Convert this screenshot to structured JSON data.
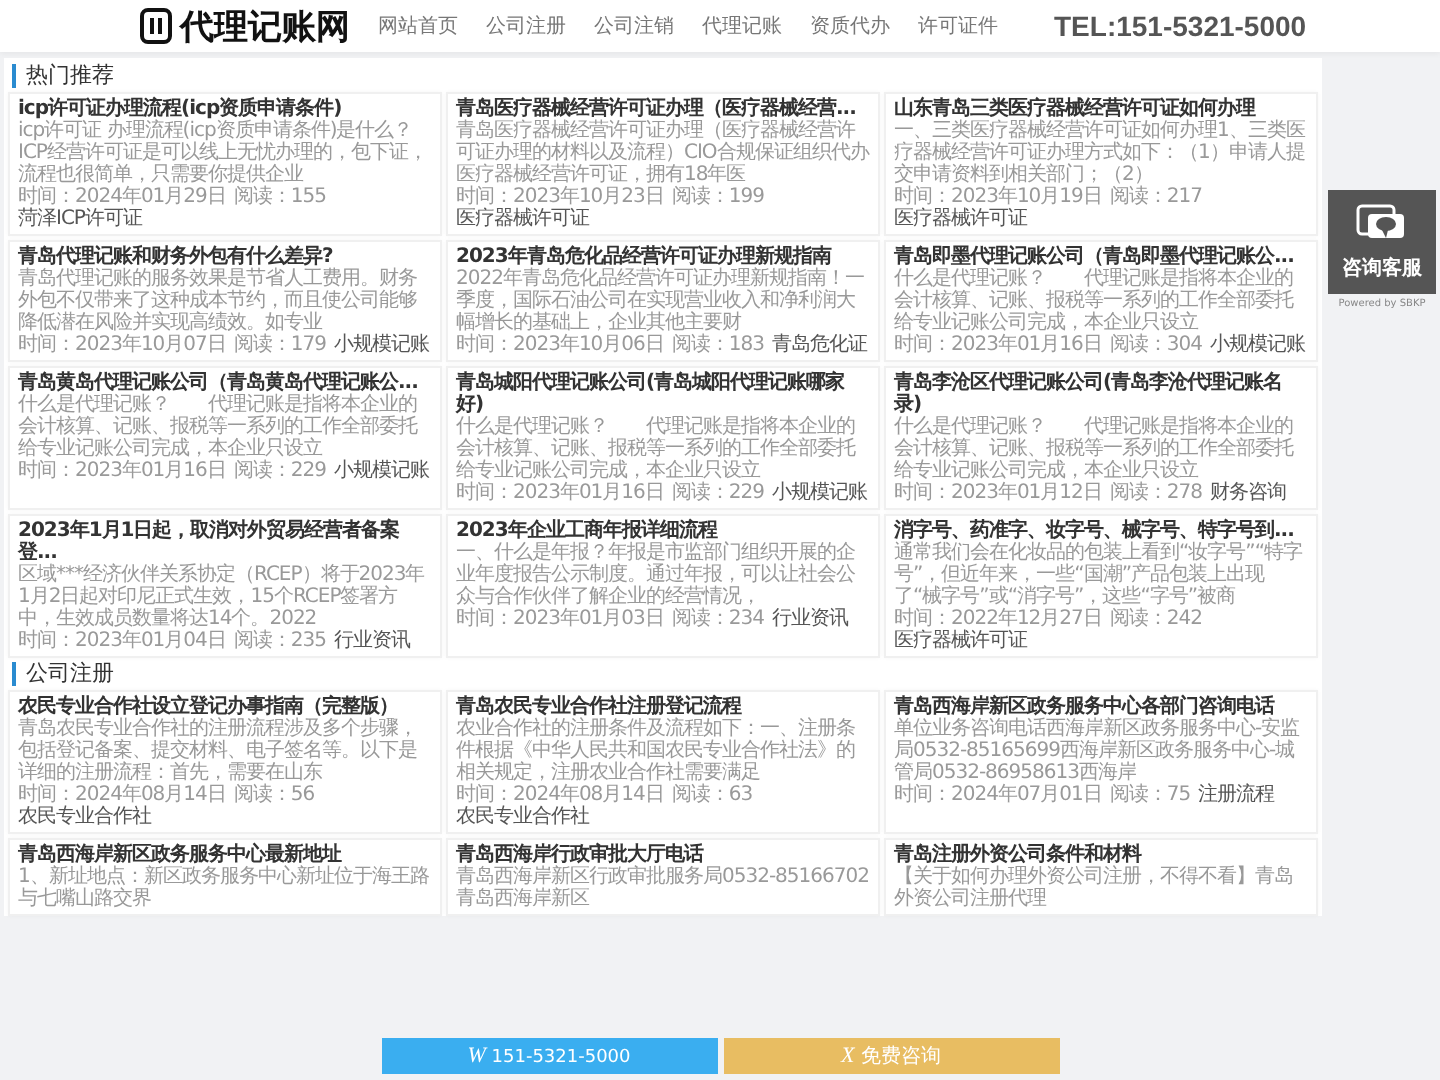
{
  "header": {
    "logo": "代理记账网",
    "nav": [
      {
        "label": "网站首页"
      },
      {
        "label": "公司注册"
      },
      {
        "label": "公司注销"
      },
      {
        "label": "代理记账"
      },
      {
        "label": "资质代办"
      },
      {
        "label": "许可证件"
      }
    ],
    "phone": "TEL:151-5321-5000"
  },
  "sections": [
    {
      "title": "热门推荐",
      "cards": [
        {
          "title": "icp许可证办理流程(icp资质申请条件)",
          "snippet": "icp许可证 办理流程(icp资质申请条件)是什么？ICP经营许可证是可以线上无忧办理的，包下证，流程也很简单，只需要你提供企业",
          "date": "时间：2024年01月29日",
          "reads": "阅读：155",
          "tag": "菏泽ICP许可证"
        },
        {
          "title": "青岛医疗器械经营许可证办理（医疗器械经营...",
          "snippet": "青岛医疗器械经营许可证办理（医疗器械经营许可证办理的材料以及流程）CIO合规保证组织代办医疗器械经营许可证，拥有18年医",
          "date": "时间：2023年10月23日",
          "reads": "阅读：199",
          "tag": "医疗器械许可证"
        },
        {
          "title": "山东青岛三类医疗器械经营许可证如何办理",
          "snippet": "一、三类医疗器械经营许可证如何办理1、三类医疗器械经营许可证办理方式如下：（1）申请人提交申请资料到相关部门；（2）",
          "date": "时间：2023年10月19日",
          "reads": "阅读：217",
          "tag": "医疗器械许可证"
        },
        {
          "title": "青岛代理记账和财务外包有什么差异?",
          "snippet": "青岛代理记账的服务效果是节省人工费用。财务外包不仅带来了这种成本节约，而且使公司能够降低潜在风险并实现高绩效。如专业",
          "date": "时间：2023年10月07日",
          "reads": "阅读：179",
          "tag": "小规模记账"
        },
        {
          "title": "2023年青岛危化品经营许可证办理新规指南",
          "snippet": "2022年青岛危化品经营许可证办理新规指南！一季度，国际石油公司在实现营业收入和净利润大幅增长的基础上，企业其他主要财",
          "date": "时间：2023年10月06日",
          "reads": "阅读：183",
          "tag": "青岛危化证"
        },
        {
          "title": "青岛即墨代理记账公司（青岛即墨代理记账公...",
          "snippet": "什么是代理记账？　　代理记账是指将本企业的会计核算、记账、报税等一系列的工作全部委托给专业记账公司完成，本企业只设立",
          "date": "时间：2023年01月16日",
          "reads": "阅读：304",
          "tag": "小规模记账"
        },
        {
          "title": "青岛黄岛代理记账公司（青岛黄岛代理记账公...",
          "snippet": "什么是代理记账？　　代理记账是指将本企业的会计核算、记账、报税等一系列的工作全部委托给专业记账公司完成，本企业只设立",
          "date": "时间：2023年01月16日",
          "reads": "阅读：229",
          "tag": "小规模记账"
        },
        {
          "title": "青岛城阳代理记账公司(青岛城阳代理记账哪家好)",
          "snippet": "什么是代理记账？　　代理记账是指将本企业的会计核算、记账、报税等一系列的工作全部委托给专业记账公司完成，本企业只设立",
          "date": "时间：2023年01月16日",
          "reads": "阅读：229",
          "tag": "小规模记账"
        },
        {
          "title": "青岛李沧区代理记账公司(青岛李沧代理记账名录)",
          "snippet": "什么是代理记账？　　代理记账是指将本企业的会计核算、记账、报税等一系列的工作全部委托给专业记账公司完成，本企业只设立",
          "date": "时间：2023年01月12日",
          "reads": "阅读：278",
          "tag": "财务咨询"
        },
        {
          "title": "2023年1月1日起，取消对外贸易经营者备案登...",
          "snippet": "区域***经济伙伴关系协定（RCEP）将于2023年1月2日起对印尼正式生效，15个RCEP签署方中，生效成员数量将达14个。2022",
          "date": "时间：2023年01月04日",
          "reads": "阅读：235",
          "tag": "行业资讯"
        },
        {
          "title": "2023年企业工商年报详细流程",
          "snippet": "一、什么是年报？年报是市监部门组织开展的企业年度报告公示制度。通过年报，可以让社会公众与合作伙伴了解企业的经营情况，",
          "date": "时间：2023年01月03日",
          "reads": "阅读：234",
          "tag": "行业资讯"
        },
        {
          "title": "消字号、药准字、妆字号、械字号、特字号到...",
          "snippet": "通常我们会在化妆品的包装上看到“妆字号”“特字号”，但近年来，一些“国潮”产品包装上出现了“械字号”或“消字号”，这些“字号”被商",
          "date": "时间：2022年12月27日",
          "reads": "阅读：242",
          "tag": "医疗器械许可证"
        }
      ]
    },
    {
      "title": "公司注册",
      "cards": [
        {
          "title": "农民专业合作社设立登记办事指南（完整版）",
          "snippet": "青岛农民专业合作社的注册流程涉及多个步骤，包括登记备案、提交材料、电子签名等。以下是详细的注册流程：首先，需要在山东",
          "date": "时间：2024年08月14日",
          "reads": "阅读：56",
          "tag": "农民专业合作社"
        },
        {
          "title": "青岛农民专业合作社注册登记流程",
          "snippet": "农业合作社的注册条件及流程如下：一、注册条件根据《中华人民共和国农民专业合作社法》的相关规定，注册农业合作社需要满足",
          "date": "时间：2024年08月14日",
          "reads": "阅读：63",
          "tag": "农民专业合作社"
        },
        {
          "title": "青岛西海岸新区政务服务中心各部门咨询电话",
          "snippet": "单位业务咨询电话西海岸新区政务服务中心-安监局0532-85165699西海岸新区政务服务中心-城管局0532-86958613西海岸",
          "date": "时间：2024年07月01日",
          "reads": "阅读：75",
          "tag": "注册流程"
        },
        {
          "title": "青岛西海岸新区政务服务中心最新地址",
          "snippet": "1、新址地点：新区政务服务中心新址位于海王路与七嘴山路交界"
        },
        {
          "title": "青岛西海岸行政审批大厅电话",
          "snippet": "青岛西海岸新区行政审批服务局0532-85166702青岛西海岸新区"
        },
        {
          "title": "青岛注册外资公司条件和材料",
          "snippet": "【关于如何办理外资公司注册，不得不看】青岛外资公司注册代理"
        }
      ]
    }
  ],
  "widget": {
    "label": "咨询客服",
    "credit": "Powered by SBKP"
  },
  "bottom_bar": [
    {
      "kind": "phone",
      "icon": "W",
      "label": "151-5321-5000"
    },
    {
      "kind": "consult",
      "icon": "X",
      "label": "免费咨询"
    }
  ]
}
